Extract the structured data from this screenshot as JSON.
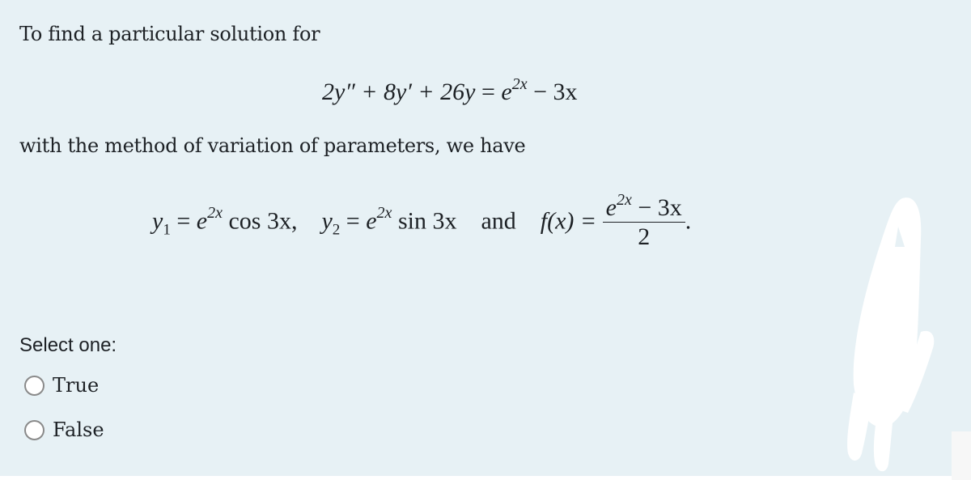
{
  "question": {
    "intro": "To find a particular solution for",
    "equation": {
      "lhs": "2y″ + 8y′ + 26y",
      "rhs_base": "e",
      "rhs_exp": "2x",
      "rhs_rest": "− 3x"
    },
    "method_text": "with the method of variation of parameters, we have",
    "given": {
      "y1_label": "y",
      "y1_sub": "1",
      "y1_base": "e",
      "y1_exp": "2x",
      "y1_rest": "cos 3x,",
      "y2_label": "y",
      "y2_sub": "2",
      "y2_base": "e",
      "y2_exp": "2x",
      "y2_rest": "sin 3x",
      "conjunction": "and",
      "f_label": "f(x) =",
      "f_num_base": "e",
      "f_num_exp": "2x",
      "f_num_rest": "− 3x",
      "f_den": "2",
      "end_punct": "."
    }
  },
  "answer": {
    "prompt": "Select one:",
    "options": [
      {
        "label": "True",
        "selected": false
      },
      {
        "label": "False",
        "selected": false
      }
    ]
  },
  "colors": {
    "panel_bg": "#e7f1f5",
    "text": "#1d2125",
    "radio_border": "#8a8a8a"
  }
}
